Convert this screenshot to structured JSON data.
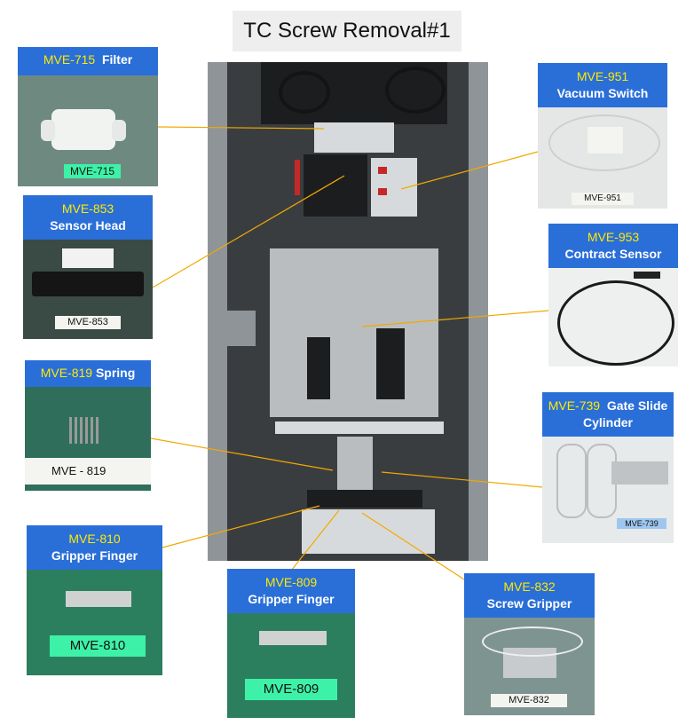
{
  "title": "TC Screw Removal#1",
  "parts": [
    {
      "code": "MVE-715",
      "name": "Filter",
      "tag": "MVE-715"
    },
    {
      "code": "MVE-853",
      "name": "Sensor Head",
      "tag": "MVE-853"
    },
    {
      "code": "MVE-819",
      "name": "Spring",
      "tag": "MVE - 819"
    },
    {
      "code": "MVE-810",
      "name": "Gripper Finger",
      "tag": "MVE-810"
    },
    {
      "code": "MVE-809",
      "name": "Gripper Finger",
      "tag": "MVE-809"
    },
    {
      "code": "MVE-832",
      "name": "Screw Gripper",
      "tag": "MVE-832"
    },
    {
      "code": "MVE-739",
      "name": "Gate Slide Cylinder",
      "tag": "MVE-739"
    },
    {
      "code": "MVE-953",
      "name": "Contract Sensor",
      "tag": ""
    },
    {
      "code": "MVE-951",
      "name": "Vacuum Switch",
      "tag": "MVE-951"
    }
  ],
  "colors": {
    "header": "#2a6fd8",
    "code_text": "#ffea00",
    "leader": "#f2a900",
    "tag_green": "#3df2a8"
  }
}
